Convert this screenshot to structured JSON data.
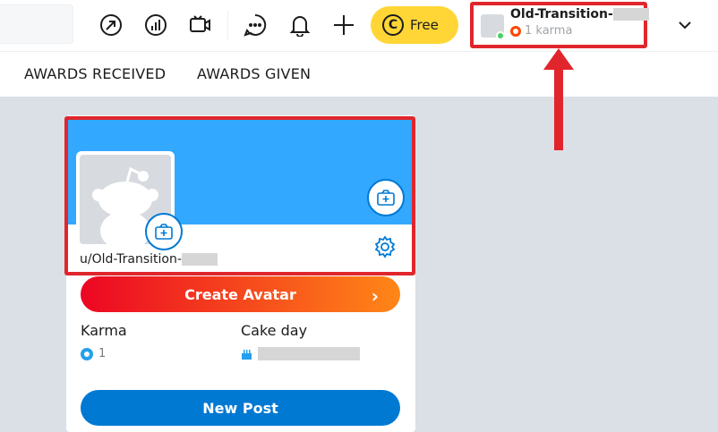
{
  "header": {
    "icons": [
      "popular-icon",
      "stats-icon",
      "video-icon",
      "chat-icon",
      "notifications-icon",
      "create-post-icon"
    ],
    "free_label": "Free",
    "coin_glyph": "C",
    "user": {
      "name": "Old-Transition-",
      "karma": "1 karma",
      "online_color": "#46d160"
    }
  },
  "tabs": [
    "AWARDS RECEIVED",
    "AWARDS GIVEN"
  ],
  "profile": {
    "banner_color": "#33a8ff",
    "username": "u/Old-Transition-",
    "create_avatar": "Create Avatar",
    "karma_label": "Karma",
    "karma_value": "1",
    "cakeday_label": "Cake day",
    "new_post": "New Post"
  },
  "colors": {
    "highlight": "#e0262c",
    "accent_blue": "#0079d3",
    "gradient_start": "#ec0623",
    "gradient_end": "#ff8717"
  }
}
